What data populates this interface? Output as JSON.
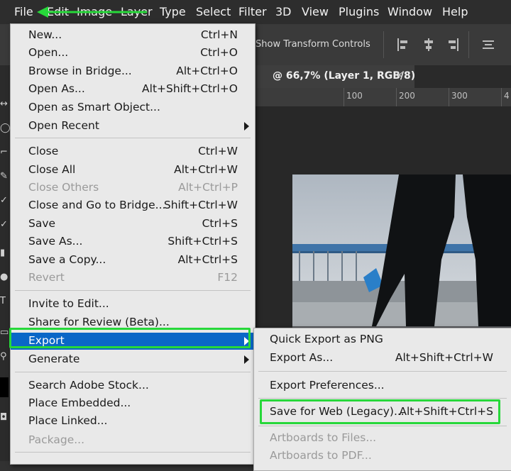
{
  "menubar": {
    "items": [
      "File",
      "Edit",
      "Image",
      "Layer",
      "Type",
      "Select",
      "Filter",
      "3D",
      "View",
      "Plugins",
      "Window",
      "Help"
    ]
  },
  "options_bar": {
    "show_transform_controls": "Show Transform Controls"
  },
  "document_tab": {
    "label": "@ 66,7% (Layer 1, RGB/8)",
    "close": "×"
  },
  "ruler": {
    "ticks": [
      "100",
      "200",
      "300",
      "4"
    ]
  },
  "file_menu": {
    "items": [
      {
        "label": "New...",
        "shortcut": "Ctrl+N"
      },
      {
        "label": "Open...",
        "shortcut": "Ctrl+O"
      },
      {
        "label": "Browse in Bridge...",
        "shortcut": "Alt+Ctrl+O"
      },
      {
        "label": "Open As...",
        "shortcut": "Alt+Shift+Ctrl+O"
      },
      {
        "label": "Open as Smart Object...",
        "shortcut": ""
      },
      {
        "label": "Open Recent",
        "shortcut": ""
      },
      {
        "label": "Close",
        "shortcut": "Ctrl+W"
      },
      {
        "label": "Close All",
        "shortcut": "Alt+Ctrl+W"
      },
      {
        "label": "Close Others",
        "shortcut": "Alt+Ctrl+P"
      },
      {
        "label": "Close and Go to Bridge...",
        "shortcut": "Shift+Ctrl+W"
      },
      {
        "label": "Save",
        "shortcut": "Ctrl+S"
      },
      {
        "label": "Save As...",
        "shortcut": "Shift+Ctrl+S"
      },
      {
        "label": "Save a Copy...",
        "shortcut": "Alt+Ctrl+S"
      },
      {
        "label": "Revert",
        "shortcut": "F12"
      },
      {
        "label": "Invite to Edit...",
        "shortcut": ""
      },
      {
        "label": "Share for Review (Beta)...",
        "shortcut": ""
      },
      {
        "label": "Export",
        "shortcut": ""
      },
      {
        "label": "Generate",
        "shortcut": ""
      },
      {
        "label": "Search Adobe Stock...",
        "shortcut": ""
      },
      {
        "label": "Place Embedded...",
        "shortcut": ""
      },
      {
        "label": "Place Linked...",
        "shortcut": ""
      },
      {
        "label": "Package...",
        "shortcut": ""
      }
    ]
  },
  "export_menu": {
    "items": [
      {
        "label": "Quick Export as PNG",
        "shortcut": ""
      },
      {
        "label": "Export As...",
        "shortcut": "Alt+Shift+Ctrl+W"
      },
      {
        "label": "Export Preferences...",
        "shortcut": ""
      },
      {
        "label": "Save for Web (Legacy)...",
        "shortcut": "Alt+Shift+Ctrl+S"
      },
      {
        "label": "Artboards to Files...",
        "shortcut": ""
      },
      {
        "label": "Artboards to PDF...",
        "shortcut": ""
      }
    ]
  },
  "colors": {
    "menu_bg": "#e9e9e9",
    "highlight": "#0a67c7",
    "annotation_green": "#27d83a",
    "app_bg": "#323232"
  }
}
